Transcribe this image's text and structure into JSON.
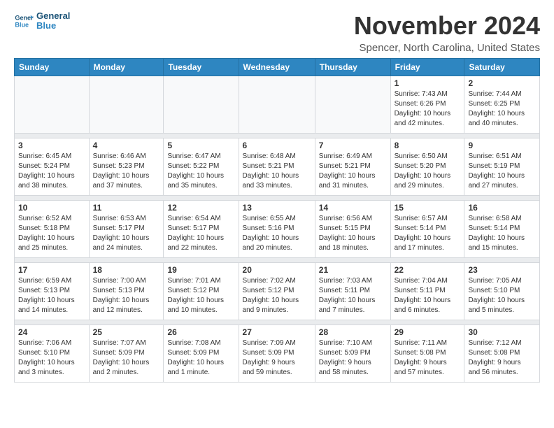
{
  "header": {
    "logo_line1": "General",
    "logo_line2": "Blue",
    "title": "November 2024",
    "location": "Spencer, North Carolina, United States"
  },
  "weekdays": [
    "Sunday",
    "Monday",
    "Tuesday",
    "Wednesday",
    "Thursday",
    "Friday",
    "Saturday"
  ],
  "weeks": [
    [
      {
        "day": "",
        "info": ""
      },
      {
        "day": "",
        "info": ""
      },
      {
        "day": "",
        "info": ""
      },
      {
        "day": "",
        "info": ""
      },
      {
        "day": "",
        "info": ""
      },
      {
        "day": "1",
        "info": "Sunrise: 7:43 AM\nSunset: 6:26 PM\nDaylight: 10 hours\nand 42 minutes."
      },
      {
        "day": "2",
        "info": "Sunrise: 7:44 AM\nSunset: 6:25 PM\nDaylight: 10 hours\nand 40 minutes."
      }
    ],
    [
      {
        "day": "3",
        "info": "Sunrise: 6:45 AM\nSunset: 5:24 PM\nDaylight: 10 hours\nand 38 minutes."
      },
      {
        "day": "4",
        "info": "Sunrise: 6:46 AM\nSunset: 5:23 PM\nDaylight: 10 hours\nand 37 minutes."
      },
      {
        "day": "5",
        "info": "Sunrise: 6:47 AM\nSunset: 5:22 PM\nDaylight: 10 hours\nand 35 minutes."
      },
      {
        "day": "6",
        "info": "Sunrise: 6:48 AM\nSunset: 5:21 PM\nDaylight: 10 hours\nand 33 minutes."
      },
      {
        "day": "7",
        "info": "Sunrise: 6:49 AM\nSunset: 5:21 PM\nDaylight: 10 hours\nand 31 minutes."
      },
      {
        "day": "8",
        "info": "Sunrise: 6:50 AM\nSunset: 5:20 PM\nDaylight: 10 hours\nand 29 minutes."
      },
      {
        "day": "9",
        "info": "Sunrise: 6:51 AM\nSunset: 5:19 PM\nDaylight: 10 hours\nand 27 minutes."
      }
    ],
    [
      {
        "day": "10",
        "info": "Sunrise: 6:52 AM\nSunset: 5:18 PM\nDaylight: 10 hours\nand 25 minutes."
      },
      {
        "day": "11",
        "info": "Sunrise: 6:53 AM\nSunset: 5:17 PM\nDaylight: 10 hours\nand 24 minutes."
      },
      {
        "day": "12",
        "info": "Sunrise: 6:54 AM\nSunset: 5:17 PM\nDaylight: 10 hours\nand 22 minutes."
      },
      {
        "day": "13",
        "info": "Sunrise: 6:55 AM\nSunset: 5:16 PM\nDaylight: 10 hours\nand 20 minutes."
      },
      {
        "day": "14",
        "info": "Sunrise: 6:56 AM\nSunset: 5:15 PM\nDaylight: 10 hours\nand 18 minutes."
      },
      {
        "day": "15",
        "info": "Sunrise: 6:57 AM\nSunset: 5:14 PM\nDaylight: 10 hours\nand 17 minutes."
      },
      {
        "day": "16",
        "info": "Sunrise: 6:58 AM\nSunset: 5:14 PM\nDaylight: 10 hours\nand 15 minutes."
      }
    ],
    [
      {
        "day": "17",
        "info": "Sunrise: 6:59 AM\nSunset: 5:13 PM\nDaylight: 10 hours\nand 14 minutes."
      },
      {
        "day": "18",
        "info": "Sunrise: 7:00 AM\nSunset: 5:13 PM\nDaylight: 10 hours\nand 12 minutes."
      },
      {
        "day": "19",
        "info": "Sunrise: 7:01 AM\nSunset: 5:12 PM\nDaylight: 10 hours\nand 10 minutes."
      },
      {
        "day": "20",
        "info": "Sunrise: 7:02 AM\nSunset: 5:12 PM\nDaylight: 10 hours\nand 9 minutes."
      },
      {
        "day": "21",
        "info": "Sunrise: 7:03 AM\nSunset: 5:11 PM\nDaylight: 10 hours\nand 7 minutes."
      },
      {
        "day": "22",
        "info": "Sunrise: 7:04 AM\nSunset: 5:11 PM\nDaylight: 10 hours\nand 6 minutes."
      },
      {
        "day": "23",
        "info": "Sunrise: 7:05 AM\nSunset: 5:10 PM\nDaylight: 10 hours\nand 5 minutes."
      }
    ],
    [
      {
        "day": "24",
        "info": "Sunrise: 7:06 AM\nSunset: 5:10 PM\nDaylight: 10 hours\nand 3 minutes."
      },
      {
        "day": "25",
        "info": "Sunrise: 7:07 AM\nSunset: 5:09 PM\nDaylight: 10 hours\nand 2 minutes."
      },
      {
        "day": "26",
        "info": "Sunrise: 7:08 AM\nSunset: 5:09 PM\nDaylight: 10 hours\nand 1 minute."
      },
      {
        "day": "27",
        "info": "Sunrise: 7:09 AM\nSunset: 5:09 PM\nDaylight: 9 hours\nand 59 minutes."
      },
      {
        "day": "28",
        "info": "Sunrise: 7:10 AM\nSunset: 5:09 PM\nDaylight: 9 hours\nand 58 minutes."
      },
      {
        "day": "29",
        "info": "Sunrise: 7:11 AM\nSunset: 5:08 PM\nDaylight: 9 hours\nand 57 minutes."
      },
      {
        "day": "30",
        "info": "Sunrise: 7:12 AM\nSunset: 5:08 PM\nDaylight: 9 hours\nand 56 minutes."
      }
    ]
  ]
}
